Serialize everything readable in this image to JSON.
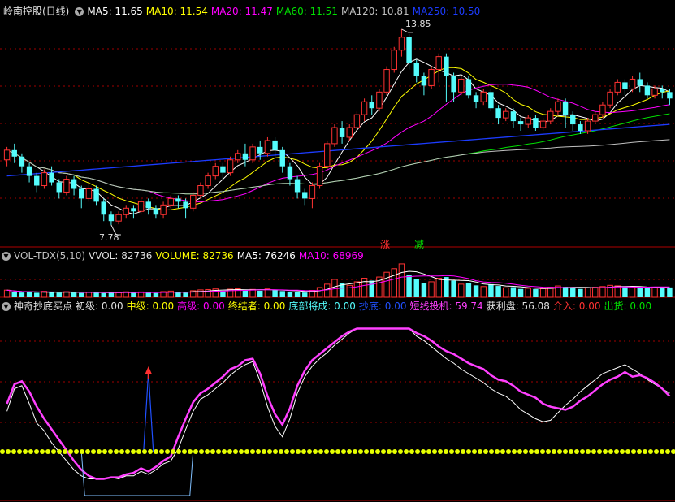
{
  "colors": {
    "up": "#ff3232",
    "down": "#54fcfc",
    "ma5": "#ffffff",
    "ma10": "#ffff00",
    "ma20": "#ff00ff",
    "ma60": "#00e000",
    "ma120": "#c0c0c0",
    "ma250": "#1c3cff",
    "grid": "#a00000",
    "pink": "#ff40ff",
    "white": "#ffffff",
    "yellowdot": "#e6ff00",
    "blue": "#2050ff",
    "label": "#c0c0c0"
  },
  "price_header": {
    "title": "岭南控股(日线)",
    "ma5": "MA5: 11.65",
    "ma10": "MA10: 11.54",
    "ma20": "MA20: 11.47",
    "ma60": "MA60: 11.51",
    "ma120": "MA120: 10.81",
    "ma250": "MA250: 10.50"
  },
  "price_annotations": {
    "high": "13.85",
    "low": "7.78",
    "rise": "涨",
    "fall": "减"
  },
  "vol_header": {
    "title": "VOL-TDX(5,10)",
    "vvol": "VVOL: 82736",
    "volume": "VOLUME: 82736",
    "ma5": "MA5: 76246",
    "ma10": "MA10: 68969"
  },
  "ind_header": {
    "title": "神奇抄底买点",
    "chuji": "初级: 0.00",
    "zhongji": "中级: 0.00",
    "gaoji": "高级: 0.00",
    "zhongjie": "终结者: 0.00",
    "dibu": "底部将成: 0.00",
    "chaodi": "抄底: 0.00",
    "duanxian": "短线投机: 59.74",
    "huoli": "获利盘: 56.08",
    "jieru": "介入: 0.00",
    "chuhuo": "出货: 0.00"
  },
  "chart_data": [
    {
      "type": "candlestick",
      "panel": "price",
      "ylim": [
        7.2,
        14.2
      ],
      "candles": [
        [
          9.8,
          10.1,
          9.6,
          10.2
        ],
        [
          10.1,
          9.9,
          9.7,
          10.3
        ],
        [
          9.9,
          9.6,
          9.4,
          10.0
        ],
        [
          9.6,
          9.3,
          9.1,
          9.7
        ],
        [
          9.3,
          9.0,
          8.8,
          9.4
        ],
        [
          9.0,
          9.4,
          8.9,
          9.5
        ],
        [
          9.4,
          9.1,
          9.0,
          9.6
        ],
        [
          9.1,
          8.8,
          8.6,
          9.2
        ],
        [
          8.8,
          9.2,
          8.7,
          9.3
        ],
        [
          9.2,
          8.9,
          8.7,
          9.3
        ],
        [
          8.9,
          8.6,
          8.3,
          9.0
        ],
        [
          8.6,
          8.9,
          8.5,
          9.1
        ],
        [
          8.9,
          8.5,
          8.4,
          9.0
        ],
        [
          8.5,
          8.1,
          7.9,
          8.6
        ],
        [
          8.1,
          7.9,
          7.78,
          8.2
        ],
        [
          7.9,
          8.1,
          7.8,
          8.2
        ],
        [
          8.1,
          8.3,
          8.0,
          8.4
        ],
        [
          8.3,
          8.2,
          8.0,
          8.4
        ],
        [
          8.2,
          8.5,
          8.1,
          8.6
        ],
        [
          8.5,
          8.3,
          8.1,
          8.6
        ],
        [
          8.3,
          8.1,
          8.0,
          8.4
        ],
        [
          8.1,
          8.4,
          8.0,
          8.5
        ],
        [
          8.4,
          8.6,
          8.3,
          8.7
        ],
        [
          8.6,
          8.5,
          8.3,
          8.7
        ],
        [
          8.5,
          8.3,
          8.0,
          8.6
        ],
        [
          8.3,
          8.7,
          8.2,
          8.8
        ],
        [
          8.7,
          9.0,
          8.6,
          9.1
        ],
        [
          9.0,
          9.3,
          8.9,
          9.4
        ],
        [
          9.3,
          9.6,
          9.2,
          9.7
        ],
        [
          9.6,
          9.4,
          9.2,
          9.7
        ],
        [
          9.4,
          9.8,
          9.3,
          9.9
        ],
        [
          9.8,
          10.0,
          9.7,
          10.1
        ],
        [
          10.0,
          9.8,
          9.6,
          10.3
        ],
        [
          9.8,
          10.2,
          9.7,
          10.3
        ],
        [
          10.2,
          10.0,
          9.8,
          10.4
        ],
        [
          10.0,
          10.4,
          9.9,
          10.5
        ],
        [
          10.4,
          10.1,
          9.9,
          10.5
        ],
        [
          10.1,
          9.6,
          9.4,
          10.2
        ],
        [
          9.6,
          9.2,
          9.0,
          9.7
        ],
        [
          9.2,
          8.8,
          8.6,
          9.3
        ],
        [
          8.8,
          8.6,
          8.4,
          8.9
        ],
        [
          8.6,
          9.0,
          8.3,
          9.1
        ],
        [
          9.0,
          9.6,
          8.9,
          9.7
        ],
        [
          9.6,
          10.3,
          9.5,
          10.4
        ],
        [
          10.3,
          10.8,
          10.2,
          10.9
        ],
        [
          10.8,
          10.5,
          10.3,
          11.0
        ],
        [
          10.5,
          10.8,
          10.4,
          10.9
        ],
        [
          10.8,
          11.2,
          10.7,
          11.3
        ],
        [
          11.2,
          11.6,
          11.0,
          11.7
        ],
        [
          11.6,
          11.4,
          11.2,
          11.8
        ],
        [
          11.4,
          11.9,
          11.3,
          12.0
        ],
        [
          11.9,
          12.6,
          11.8,
          12.7
        ],
        [
          12.6,
          13.2,
          12.5,
          13.3
        ],
        [
          13.2,
          13.6,
          13.0,
          13.85
        ],
        [
          13.6,
          12.8,
          12.6,
          13.7
        ],
        [
          12.8,
          12.4,
          12.2,
          12.9
        ],
        [
          12.4,
          12.1,
          11.8,
          12.5
        ],
        [
          12.1,
          12.6,
          12.0,
          12.7
        ],
        [
          12.6,
          13.0,
          12.2,
          13.1
        ],
        [
          13.0,
          12.4,
          11.6,
          13.1
        ],
        [
          12.4,
          11.9,
          11.6,
          12.5
        ],
        [
          11.9,
          12.3,
          11.8,
          12.4
        ],
        [
          12.3,
          11.8,
          11.7,
          12.4
        ],
        [
          11.8,
          11.6,
          11.4,
          11.9
        ],
        [
          11.6,
          11.9,
          11.5,
          12.0
        ],
        [
          11.9,
          11.4,
          11.3,
          12.0
        ],
        [
          11.4,
          11.1,
          10.9,
          11.5
        ],
        [
          11.1,
          11.3,
          11.0,
          11.4
        ],
        [
          11.3,
          11.0,
          10.8,
          11.4
        ],
        [
          11.0,
          10.9,
          10.7,
          11.1
        ],
        [
          10.9,
          11.1,
          10.8,
          11.2
        ],
        [
          11.1,
          10.8,
          10.7,
          11.2
        ],
        [
          10.8,
          11.0,
          10.7,
          11.1
        ],
        [
          11.0,
          11.3,
          10.9,
          11.4
        ],
        [
          11.3,
          11.6,
          11.2,
          11.7
        ],
        [
          11.6,
          11.2,
          10.8,
          11.7
        ],
        [
          11.2,
          10.9,
          10.7,
          11.3
        ],
        [
          10.9,
          10.7,
          10.6,
          11.0
        ],
        [
          10.7,
          11.0,
          10.6,
          11.1
        ],
        [
          11.0,
          11.2,
          10.9,
          11.3
        ],
        [
          11.2,
          11.5,
          11.1,
          11.6
        ],
        [
          11.5,
          11.9,
          11.4,
          12.0
        ],
        [
          11.9,
          12.2,
          11.8,
          12.3
        ],
        [
          12.2,
          12.0,
          11.8,
          12.3
        ],
        [
          12.0,
          12.3,
          11.9,
          12.4
        ],
        [
          12.3,
          12.1,
          11.9,
          12.5
        ],
        [
          12.1,
          11.8,
          11.7,
          12.2
        ],
        [
          11.8,
          12.0,
          11.7,
          12.1
        ],
        [
          12.0,
          11.9,
          11.7,
          12.1
        ],
        [
          11.9,
          11.7,
          11.5,
          12.0
        ]
      ]
    },
    {
      "type": "bar",
      "panel": "volume",
      "ylim": [
        0,
        300000
      ],
      "values": [
        60000,
        45000,
        40000,
        42000,
        38000,
        50000,
        41000,
        39000,
        47000,
        40000,
        36000,
        44000,
        38000,
        35000,
        42000,
        39000,
        46000,
        37000,
        45000,
        40000,
        36000,
        48000,
        52000,
        41000,
        39000,
        55000,
        62000,
        65000,
        70000,
        50000,
        68000,
        72000,
        58000,
        66000,
        55000,
        70000,
        60000,
        52000,
        48000,
        44000,
        40000,
        58000,
        82000,
        110000,
        150000,
        120000,
        100000,
        130000,
        160000,
        140000,
        170000,
        210000,
        240000,
        280000,
        190000,
        150000,
        120000,
        130000,
        160000,
        170000,
        140000,
        110000,
        120000,
        100000,
        90000,
        110000,
        95000,
        80000,
        85000,
        70000,
        75000,
        68000,
        72000,
        85000,
        95000,
        88000,
        78000,
        70000,
        80000,
        84000,
        90000,
        100000,
        96000,
        85000,
        90000,
        82000,
        76000,
        80000,
        84000,
        82736
      ]
    },
    {
      "type": "line",
      "panel": "indicator",
      "ylim": [
        -10,
        110
      ],
      "series": [
        {
          "values": [
            50,
            63,
            65,
            58,
            48,
            40,
            33,
            26,
            19,
            12,
            6,
            2,
            0,
            0,
            1,
            1,
            3,
            4,
            7,
            5,
            8,
            12,
            15,
            28,
            40,
            51,
            57,
            60,
            64,
            68,
            73,
            75,
            79,
            80,
            70,
            55,
            43,
            36,
            47,
            62,
            72,
            79,
            83,
            87,
            91,
            95,
            98,
            100,
            100,
            100,
            100,
            100,
            100,
            100,
            100,
            97,
            95,
            92,
            88,
            85,
            83,
            80,
            77,
            75,
            73,
            69,
            66,
            65,
            62,
            58,
            56,
            54,
            50,
            48,
            47,
            46,
            48,
            52,
            55,
            59,
            63,
            66,
            68,
            71,
            68,
            69,
            67,
            64,
            60,
            55
          ]
        },
        {
          "values": [
            45,
            60,
            62,
            50,
            37,
            32,
            24,
            18,
            12,
            6,
            2,
            0,
            0,
            0,
            1,
            0,
            2,
            2,
            5,
            3,
            6,
            10,
            12,
            20,
            33,
            45,
            53,
            56,
            60,
            64,
            69,
            73,
            76,
            78,
            65,
            48,
            35,
            28,
            40,
            57,
            68,
            75,
            80,
            84,
            89,
            93,
            97,
            100,
            100,
            100,
            100,
            100,
            100,
            100,
            100,
            95,
            92,
            88,
            84,
            80,
            77,
            73,
            70,
            67,
            64,
            60,
            57,
            55,
            51,
            46,
            43,
            40,
            38,
            39,
            44,
            49,
            53,
            58,
            62,
            66,
            70,
            72,
            74,
            76,
            73,
            70,
            66,
            63,
            60,
            57
          ]
        }
      ]
    }
  ]
}
